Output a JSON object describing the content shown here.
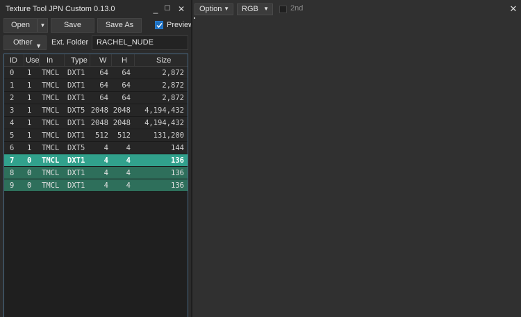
{
  "window": {
    "title": "Texture Tool JPN Custom 0.13.0",
    "minimize_glyph": "_",
    "maximize_glyph": "☐",
    "close_glyph": "✕"
  },
  "toolbar": {
    "open_label": "Open",
    "save_label": "Save",
    "save_as_label": "Save As",
    "preview_label": "Preview",
    "preview_checked": true,
    "other_label": "Other",
    "ext_folder_label": "Ext. Folder",
    "ext_folder_value": "RACHEL_NUDE",
    "dropdown_arrow": "▼"
  },
  "table": {
    "columns": [
      "ID",
      "Use",
      "In",
      "Type",
      "W",
      "H",
      "Size"
    ],
    "rows": [
      {
        "id": "0",
        "use": "1",
        "in": "TMCL",
        "type": "DXT1",
        "w": "64",
        "h": "64",
        "size": "2,872",
        "state": "plain"
      },
      {
        "id": "1",
        "use": "1",
        "in": "TMCL",
        "type": "DXT1",
        "w": "64",
        "h": "64",
        "size": "2,872",
        "state": "plain"
      },
      {
        "id": "2",
        "use": "1",
        "in": "TMCL",
        "type": "DXT1",
        "w": "64",
        "h": "64",
        "size": "2,872",
        "state": "plain"
      },
      {
        "id": "3",
        "use": "1",
        "in": "TMCL",
        "type": "DXT5",
        "w": "2048",
        "h": "2048",
        "size": "4,194,432",
        "state": "plain"
      },
      {
        "id": "4",
        "use": "1",
        "in": "TMCL",
        "type": "DXT1",
        "w": "2048",
        "h": "2048",
        "size": "4,194,432",
        "state": "plain"
      },
      {
        "id": "5",
        "use": "1",
        "in": "TMCL",
        "type": "DXT1",
        "w": "512",
        "h": "512",
        "size": "131,200",
        "state": "plain"
      },
      {
        "id": "6",
        "use": "1",
        "in": "TMCL",
        "type": "DXT5",
        "w": "4",
        "h": "4",
        "size": "144",
        "state": "plain"
      },
      {
        "id": "7",
        "use": "0",
        "in": "TMCL",
        "type": "DXT1",
        "w": "4",
        "h": "4",
        "size": "136",
        "state": "sel"
      },
      {
        "id": "8",
        "use": "0",
        "in": "TMCL",
        "type": "DXT1",
        "w": "4",
        "h": "4",
        "size": "136",
        "state": "hi"
      },
      {
        "id": "9",
        "use": "0",
        "in": "TMCL",
        "type": "DXT1",
        "w": "4",
        "h": "4",
        "size": "136",
        "state": "hi"
      }
    ]
  },
  "viewer": {
    "option_label": "Option",
    "channel_value": "RGB",
    "second_label": "2nd",
    "second_checked": false,
    "close_glyph": "✕"
  },
  "colors": {
    "selected_row": "#31a18c",
    "highlighted_row": "#2e6f5b",
    "checkbox_accent": "#1e6fbf"
  }
}
